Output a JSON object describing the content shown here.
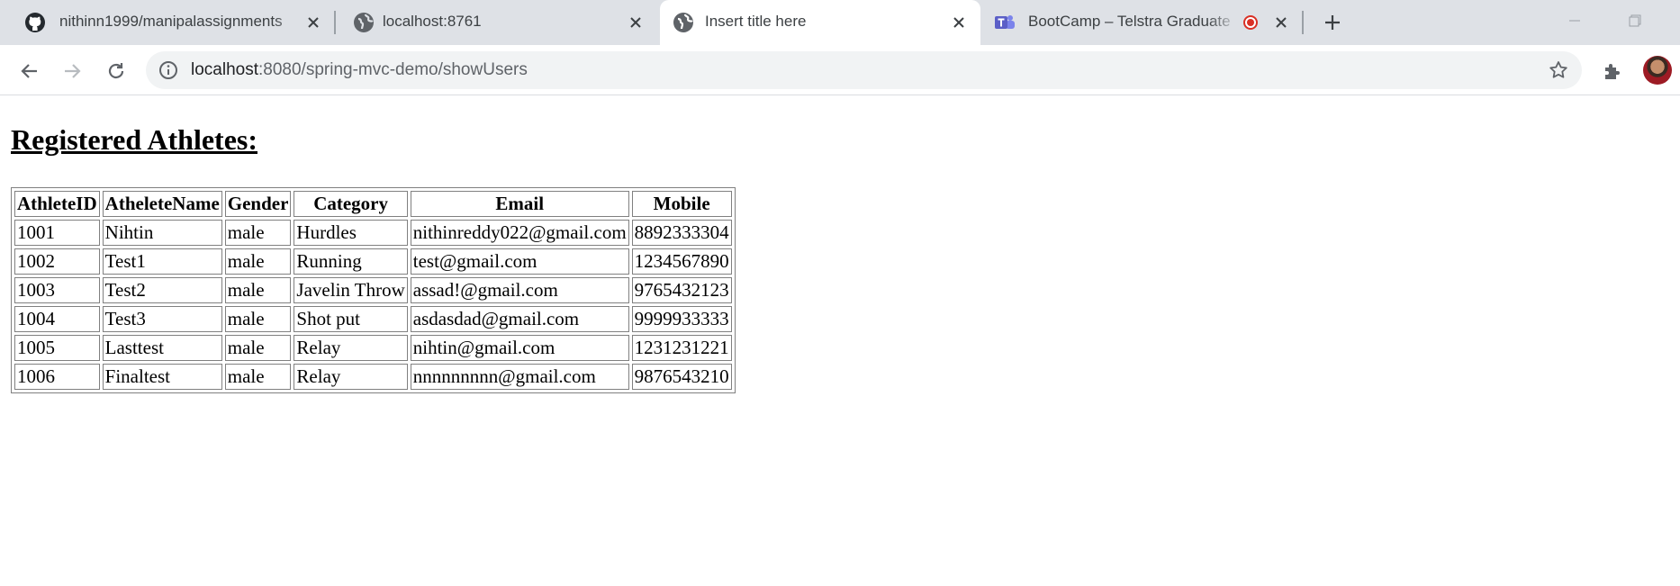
{
  "browser": {
    "tabs": [
      {
        "title": "nithinn1999/manipalassignments",
        "favicon": "github-icon"
      },
      {
        "title": "localhost:8761",
        "favicon": "globe-icon"
      },
      {
        "title": "Insert title here",
        "favicon": "globe-icon",
        "active": true
      },
      {
        "title": "BootCamp – Telstra Graduate",
        "favicon": "teams-icon",
        "recording": true
      }
    ],
    "url_host": "localhost",
    "url_path": ":8080/spring-mvc-demo/showUsers",
    "colors": {
      "tabstrip": "#dee1e6",
      "omnibox": "#f1f3f4",
      "recording": "#d93025",
      "teams": "#5b5fc7"
    }
  },
  "page": {
    "heading": "Registered Athletes:",
    "table": {
      "columns": [
        "AthleteID",
        "AtheleteName",
        "Gender",
        "Category",
        "Email",
        "Mobile"
      ],
      "rows": [
        [
          "1001",
          "Nihtin",
          "male",
          "Hurdles",
          "nithinreddy022@gmail.com",
          "8892333304"
        ],
        [
          "1002",
          "Test1",
          "male",
          "Running",
          "test@gmail.com",
          "1234567890"
        ],
        [
          "1003",
          "Test2",
          "male",
          "Javelin Throw",
          "assad!@gmail.com",
          "9765432123"
        ],
        [
          "1004",
          "Test3",
          "male",
          "Shot put",
          "asdasdad@gmail.com",
          "9999933333"
        ],
        [
          "1005",
          "Lasttest",
          "male",
          "Relay",
          "nihtin@gmail.com",
          "1231231221"
        ],
        [
          "1006",
          "Finaltest",
          "male",
          "Relay",
          "nnnnnnnnn@gmail.com",
          "9876543210"
        ]
      ]
    }
  }
}
